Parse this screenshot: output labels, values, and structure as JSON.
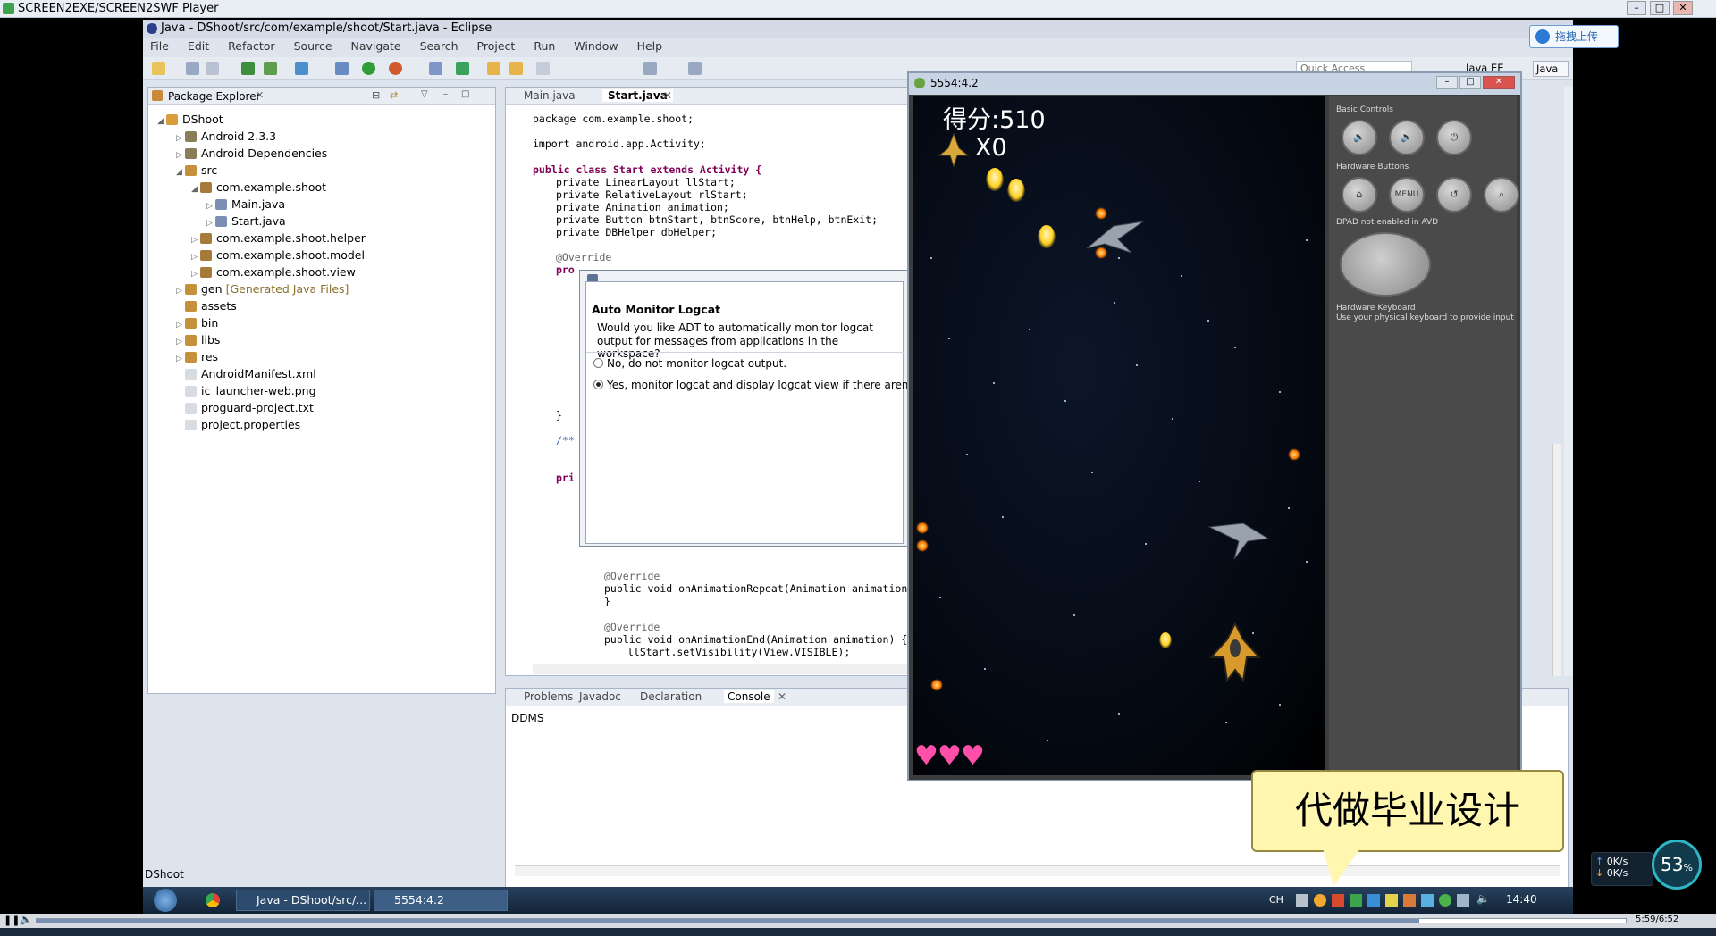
{
  "player": {
    "title": "SCREEN2EXE/SCREEN2SWF Player",
    "time": "5:59/6:52"
  },
  "eclipse": {
    "title": "Java - DShoot/src/com/example/shoot/Start.java - Eclipse",
    "menu": [
      "File",
      "Edit",
      "Refactor",
      "Source",
      "Navigate",
      "Search",
      "Project",
      "Run",
      "Window",
      "Help"
    ],
    "quick_access": "Quick Access",
    "perspectives": [
      "Java EE",
      "Java"
    ],
    "status": "DShoot"
  },
  "package_explorer": {
    "tab_label": "Package Explorer",
    "project": "DShoot",
    "items": [
      {
        "label": "Android 2.3.3",
        "depth": 1
      },
      {
        "label": "Android Dependencies",
        "depth": 1
      },
      {
        "label": "src",
        "depth": 1
      },
      {
        "label": "com.example.shoot",
        "depth": 2
      },
      {
        "label": "Main.java",
        "depth": 3
      },
      {
        "label": "Start.java",
        "depth": 3
      },
      {
        "label": "com.example.shoot.helper",
        "depth": 2
      },
      {
        "label": "com.example.shoot.model",
        "depth": 2
      },
      {
        "label": "com.example.shoot.view",
        "depth": 2
      },
      {
        "label": "gen",
        "suffix": "[Generated Java Files]",
        "depth": 1
      },
      {
        "label": "assets",
        "depth": 1
      },
      {
        "label": "bin",
        "depth": 1
      },
      {
        "label": "libs",
        "depth": 1
      },
      {
        "label": "res",
        "depth": 1
      },
      {
        "label": "AndroidManifest.xml",
        "depth": 1
      },
      {
        "label": "ic_launcher-web.png",
        "depth": 1
      },
      {
        "label": "proguard-project.txt",
        "depth": 1
      },
      {
        "label": "project.properties",
        "depth": 1
      }
    ]
  },
  "editor": {
    "tabs": [
      "Main.java",
      "Start.java"
    ],
    "code": {
      "package": "package com.example.shoot;",
      "import": "import android.app.Activity;",
      "class_decl": "public class Start extends Activity {",
      "f1": "private LinearLayout llStart;",
      "f2": "private RelativeLayout rlStart;",
      "f3": "private Animation animation;",
      "f4": "private Button btnStart, btnScore, btnHelp, btnExit;",
      "f5": "private DBHelper dbHelper;",
      "override1": "@Override",
      "pro": "pro",
      "brace": "}",
      "comment": "/**",
      "pri": "pri",
      "override2": "@Override",
      "repeat": "public void onAnimationRepeat(Animation animation)",
      "brace2": "}",
      "override3": "@Override",
      "end": "public void onAnimationEnd(Animation animation) {",
      "visible": "llStart.setVisibility(View.VISIBLE);"
    }
  },
  "dialog": {
    "title": "Auto Monitor Logcat",
    "message_1": "Would you like ADT to automatically monitor logcat",
    "message_2": "output for messages from applications in the workspace?",
    "option_no": "No, do not monitor logcat output.",
    "option_yes": "Yes, monitor logcat and display logcat view if there aremess"
  },
  "console": {
    "tabs": [
      "Problems",
      "Javadoc",
      "Declaration",
      "Console"
    ],
    "active_tab": "Console",
    "content": "DDMS"
  },
  "emulator": {
    "title": "5554:4.2",
    "game": {
      "score_label": "得分:510",
      "multiplier": "X0",
      "lives": 3
    },
    "controls": {
      "basic_controls": "Basic Controls",
      "hardware_buttons": "Hardware Buttons",
      "menu_label": "MENU",
      "dpad_note": "DPAD not enabled in AVD",
      "keyboard_title": "Hardware Keyboard",
      "keyboard_note": "Use your physical keyboard to provide input"
    }
  },
  "overlay": {
    "bubble_text": "代做毕业设计",
    "upload_label": "拖拽上传",
    "net_speed_pct": "53",
    "pct_sign": "%",
    "up_rate": "0K/s",
    "down_rate": "0K/s"
  },
  "taskbar": {
    "tasks": [
      "Java - DShoot/src/...",
      "5554:4.2"
    ],
    "lang": "CH",
    "clock": "14:40"
  },
  "colors": {
    "keyword": "#7f0055",
    "field": "#0000c0",
    "annotation": "#646464"
  }
}
